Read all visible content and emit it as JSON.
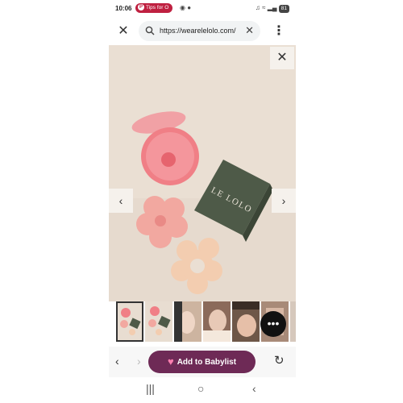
{
  "status_bar": {
    "time": "10:06",
    "notification": "Tips for O",
    "notification_icon": "pinterest-p",
    "battery": "81"
  },
  "browser": {
    "url": "https://wearelelolo.com/",
    "close_glyph": "✕",
    "clear_glyph": "✕",
    "menu_glyph": "⋮"
  },
  "gallery": {
    "close_glyph": "✕",
    "prev_glyph": "‹",
    "next_glyph": "›",
    "brand_logo": "LE LOLO",
    "thumbnail_count": 7,
    "selected_thumbnail": 1
  },
  "chat": {
    "glyph": "•••"
  },
  "toolbar": {
    "back_glyph": "‹",
    "forward_glyph": "›",
    "babylist_label": "Add to Babylist",
    "heart_glyph": "♥",
    "reload_glyph": "↻"
  },
  "system_nav": {
    "recents_glyph": "|||",
    "home_glyph": "○",
    "back_glyph": "‹"
  },
  "colors": {
    "babylist_button": "#6e2a56",
    "notification_pill": "#bf2040",
    "product_background": "#eadfd3"
  }
}
